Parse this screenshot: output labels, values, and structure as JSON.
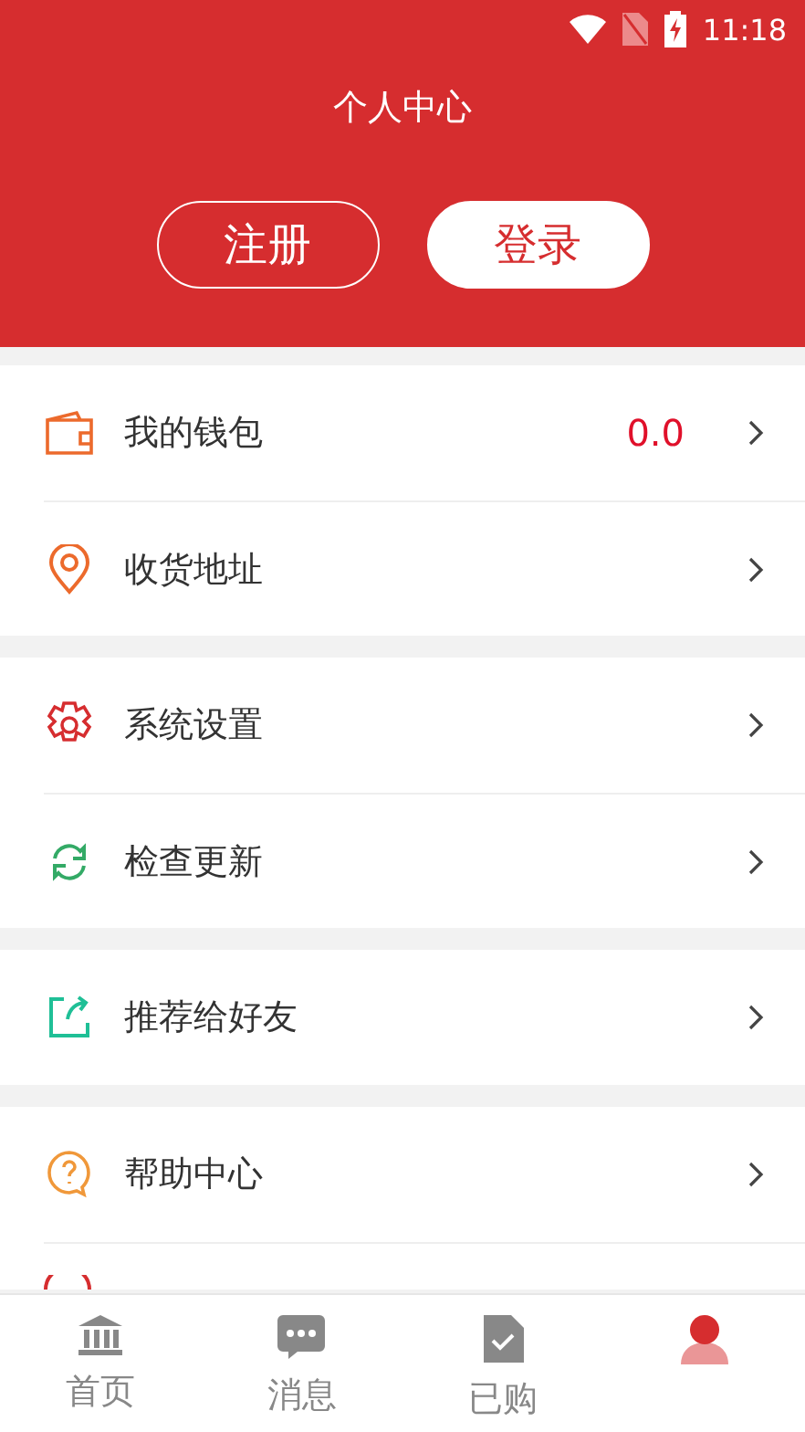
{
  "status_bar": {
    "time": "11:18"
  },
  "header": {
    "title": "个人中心",
    "buttons": [
      {
        "label": "注册",
        "kind": "outline"
      },
      {
        "label": "登录",
        "kind": "filled"
      }
    ]
  },
  "sections": [
    {
      "items": [
        {
          "label": "我的钱包",
          "value": "0.0"
        },
        {
          "label": "收货地址"
        }
      ]
    },
    {
      "items": [
        {
          "label": "系统设置"
        },
        {
          "label": "检查更新"
        }
      ]
    },
    {
      "items": [
        {
          "label": "推荐给好友"
        }
      ]
    },
    {
      "items": [
        {
          "label": "帮助中心"
        }
      ],
      "cut_row": true
    }
  ],
  "bottom_nav": [
    {
      "label": "首页",
      "selected": false
    },
    {
      "label": "消息",
      "selected": false
    },
    {
      "label": "已购",
      "selected": false
    },
    {
      "selected": true
    }
  ]
}
